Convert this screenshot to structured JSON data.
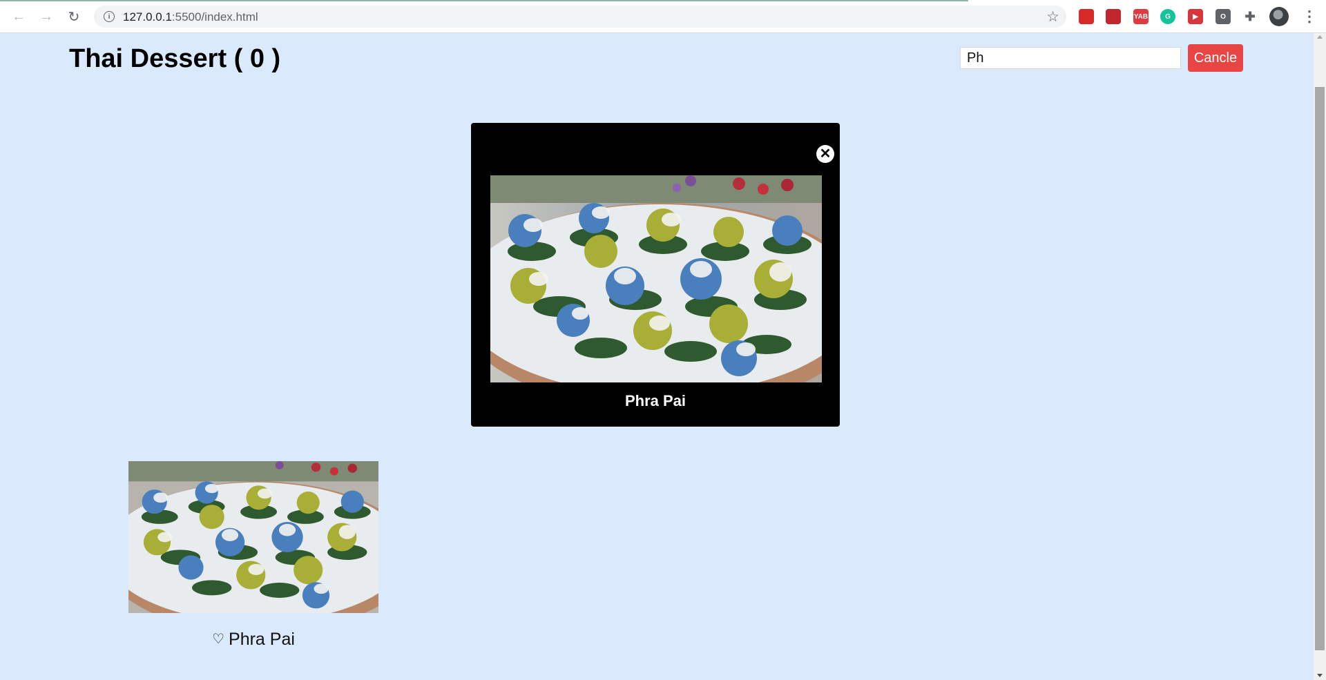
{
  "browser": {
    "url_host": "127.0.0.1",
    "url_rest": ":5500/index.html",
    "info_glyph": "i",
    "back_glyph": "←",
    "forward_glyph": "→",
    "reload_glyph": "↻",
    "star_glyph": "☆",
    "menu_glyph": "⋮",
    "extensions": [
      {
        "name": "adblock-extension-icon",
        "label": "",
        "color": "#d92a2a"
      },
      {
        "name": "pdf-extension-icon",
        "label": "",
        "color": "#c1272d"
      },
      {
        "name": "yab-extension-icon",
        "label": "YAB",
        "color": "#e0393e"
      },
      {
        "name": "grammarly-extension-icon",
        "label": "G",
        "color": "#15c39a"
      },
      {
        "name": "video-extension-icon",
        "label": "▶",
        "color": "#d8363a"
      },
      {
        "name": "screen-extension-icon",
        "label": "O",
        "color": "#5f6368"
      },
      {
        "name": "puzzle-extension-icon",
        "label": "",
        "color": "#5f6368"
      }
    ]
  },
  "header": {
    "title": "Thai Dessert ( 0 )",
    "search_value": "Ph",
    "cancel_label": "Cancle"
  },
  "modal": {
    "close_glyph": "✕",
    "caption": "Phra Pai"
  },
  "cards": [
    {
      "heart_glyph": "♡",
      "name": "Phra Pai"
    }
  ]
}
